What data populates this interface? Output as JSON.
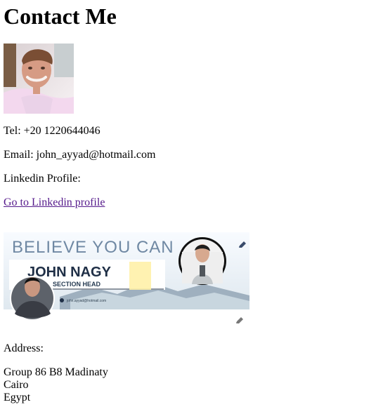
{
  "page": {
    "title": "Contact Me"
  },
  "contact": {
    "tel": "Tel: +20 1220644046",
    "email": "Email: john_ayyad@hotmail.com",
    "linkedin_label": "Linkedin Profile:",
    "linkedin_link": "Go to Linkedin profile"
  },
  "banner": {
    "headline": "BELIEVE YOU CAN",
    "name": "JOHN NAGY",
    "role": "SECTION HEAD",
    "contact": "john.ayyad@hotmail.com",
    "icons": [
      "edit-icon",
      "edit-icon"
    ]
  },
  "address": {
    "label": "Address:",
    "line1": "Group 86 B8 Madinaty",
    "line2": "Cairo",
    "line3": "Egypt"
  },
  "colors": {
    "link": "#551a8b",
    "banner_text": "#6f88a3",
    "banner_dark": "#1f2f46"
  }
}
